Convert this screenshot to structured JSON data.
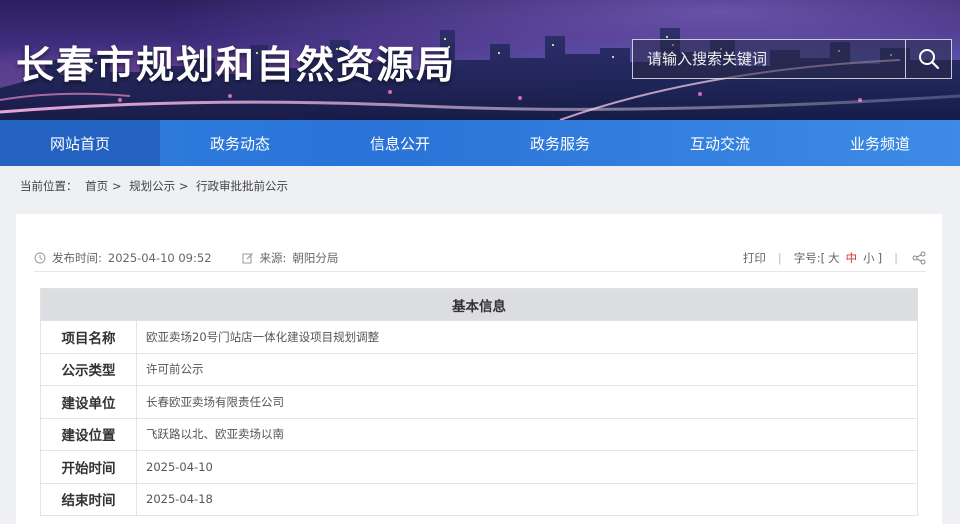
{
  "header": {
    "site_title": "长春市规划和自然资源局",
    "search_placeholder": "请输入搜索关键词",
    "search_icon": "search-icon"
  },
  "nav": {
    "items": [
      {
        "label": "网站首页",
        "active": true
      },
      {
        "label": "政务动态",
        "active": false
      },
      {
        "label": "信息公开",
        "active": false
      },
      {
        "label": "政务服务",
        "active": false
      },
      {
        "label": "互动交流",
        "active": false
      },
      {
        "label": "业务频道",
        "active": false
      }
    ]
  },
  "breadcrumb": {
    "prefix": "当前位置：",
    "items": [
      "首页",
      "规划公示",
      "行政审批批前公示"
    ],
    "separator": ">"
  },
  "meta": {
    "publish_label": "发布时间:",
    "publish_time": "2025-04-10 09:52",
    "source_label": "来源:",
    "source": "朝阳分局",
    "print": "打印",
    "font_label": "字号:",
    "font_open": "[",
    "font_large": "大",
    "font_mid": "中",
    "font_small": "小",
    "font_close": "]",
    "sep": "|",
    "mid_font_color": "#dd3333"
  },
  "table": {
    "header": "基本信息",
    "rows": [
      {
        "key": "项目名称",
        "value": "欧亚卖场20号门站店一体化建设项目规划调整"
      },
      {
        "key": "公示类型",
        "value": "许可前公示"
      },
      {
        "key": "建设单位",
        "value": "长春欧亚卖场有限责任公司"
      },
      {
        "key": "建设位置",
        "value": "飞跃路以北、欧亚卖场以南"
      },
      {
        "key": "开始时间",
        "value": "2025-04-10"
      },
      {
        "key": "结束时间",
        "value": "2025-04-18"
      }
    ]
  },
  "colors": {
    "nav_bg": "#2a73d8",
    "nav_active": "#2462c2",
    "table_header_bg": "#dcdde0"
  }
}
